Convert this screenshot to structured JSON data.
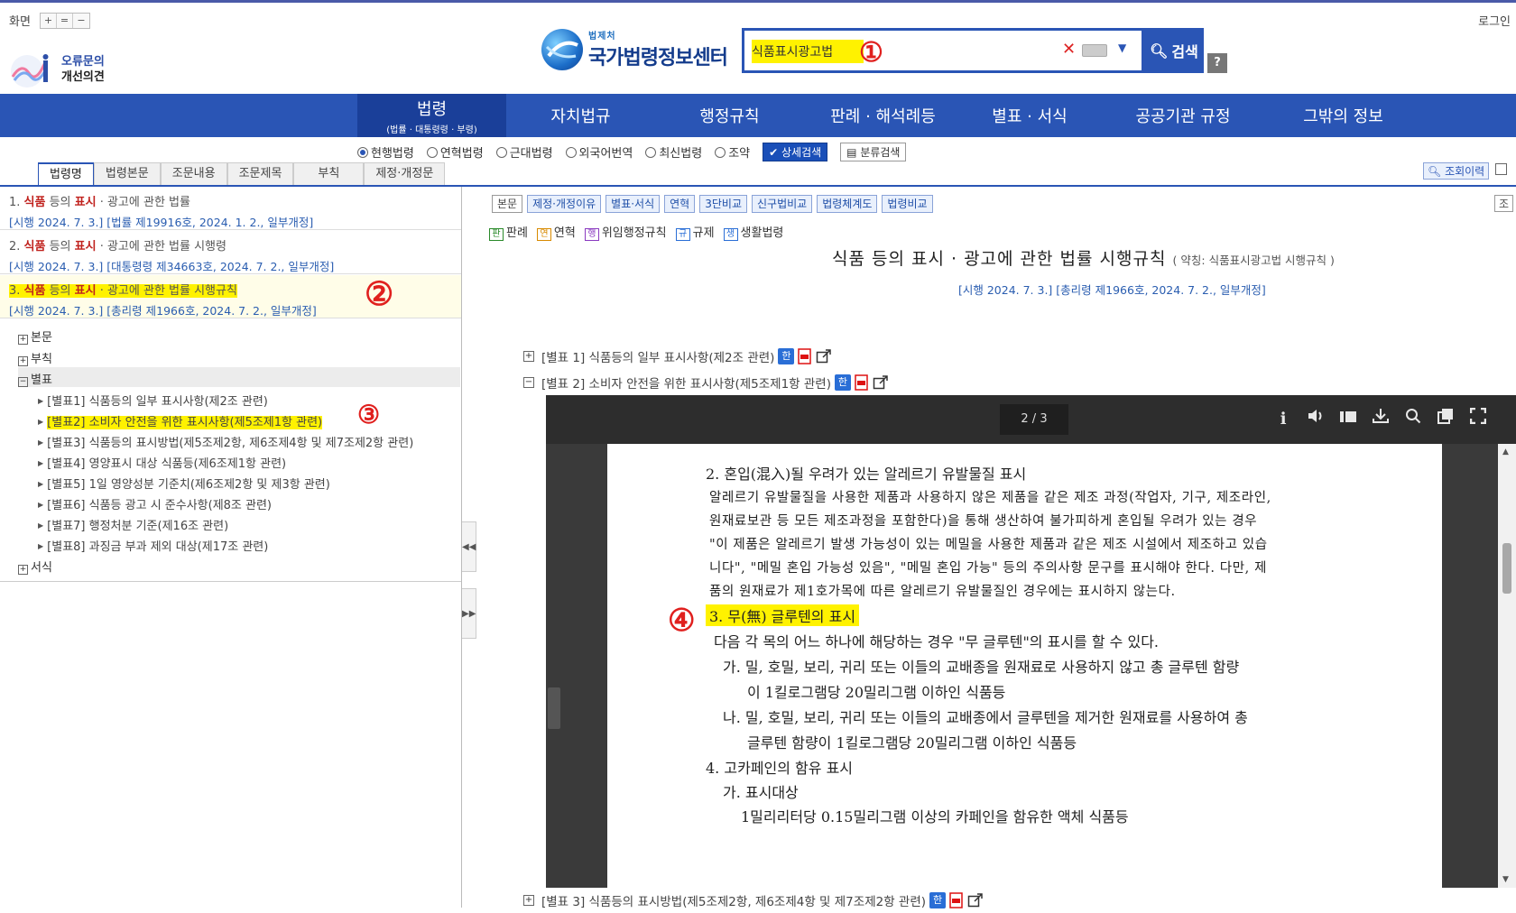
{
  "top": {
    "screen_label": "화면",
    "zoom_buttons": [
      "+",
      "=",
      "−"
    ],
    "login": "로그인",
    "feedback_line1": "오류문의",
    "feedback_line2": "개선의견",
    "logo_small": "법제처",
    "logo_big": "국가법령정보센터",
    "search_value": "식품표시광고법",
    "search_button": "검색",
    "help": "?"
  },
  "annotations": {
    "a1": "①",
    "a2": "②",
    "a3": "③",
    "a4": "④"
  },
  "nav": [
    {
      "label": "법령",
      "sub": "(법률 · 대통령령 · 부령)"
    },
    {
      "label": "자치법규"
    },
    {
      "label": "행정규칙"
    },
    {
      "label": "판례 · 해석례등"
    },
    {
      "label": "별표 · 서식"
    },
    {
      "label": "공공기관 규정"
    },
    {
      "label": "그밖의 정보"
    }
  ],
  "options": {
    "radios": [
      "현행법령",
      "연혁법령",
      "근대법령",
      "외국어번역",
      "최신법령",
      "조약"
    ],
    "detail_search": "상세검색",
    "category_search": "분류검색",
    "view_history": "조회이력"
  },
  "left_tabs": [
    "법령명",
    "법령본문",
    "조문내용",
    "조문제목",
    "부칙",
    "제정·개정문"
  ],
  "laws": [
    {
      "num": "1.",
      "a": "식품",
      "b": " 등의 ",
      "c": "표시",
      "d": " · 광고에 관한 법률",
      "sub": "[시행 2024. 7. 3.] [법률 제19916호, 2024. 1. 2., 일부개정]"
    },
    {
      "num": "2.",
      "a": "식품",
      "b": " 등의 ",
      "c": "표시",
      "d": " · 광고에 관한 법률 시행령",
      "sub": "[시행 2024. 7. 3.] [대통령령 제34663호, 2024. 7. 2., 일부개정]"
    },
    {
      "num": "3.",
      "a": "식품",
      "b": " 등의 ",
      "c": "표시",
      "d": " · 광고에 관한 법률 시행규칙",
      "sub": "[시행 2024. 7. 3.] [총리령 제1966호, 2024. 7. 2., 일부개정]"
    }
  ],
  "tree": {
    "body": "본문",
    "addenda": "부칙",
    "annex": "별표",
    "forms": "서식"
  },
  "annex_items": [
    "[별표1] 식품등의 일부 표시사항(제2조 관련)",
    "[별표2] 소비자 안전을 위한 표시사항(제5조제1항 관련)",
    "[별표3] 식품등의 표시방법(제5조제2항, 제6조제4항 및 제7조제2항 관련)",
    "[별표4] 영양표시 대상 식품등(제6조제1항 관련)",
    "[별표5] 1일 영양성분 기준치(제6조제2항 및 제3항 관련)",
    "[별표6] 식품등 광고 시 준수사항(제8조 관련)",
    "[별표7] 행정처분 기준(제16조 관련)",
    "[별표8] 과징금 부과 제외 대상(제17조 관련)"
  ],
  "right_buttons": [
    "본문",
    "제정·개정이유",
    "별표·서식",
    "연혁",
    "3단비교",
    "신구법비교",
    "법령체계도",
    "법령비교"
  ],
  "right_corner": "조",
  "legend": [
    {
      "icon": "판",
      "label": "판례"
    },
    {
      "icon": "연",
      "label": "연혁"
    },
    {
      "icon": "행",
      "label": "위임행정규칙"
    },
    {
      "icon": "규",
      "label": "규제"
    },
    {
      "icon": "생",
      "label": "생활법령"
    }
  ],
  "doc": {
    "title": "식품 등의 표시 · 광고에 관한 법률 시행규칙",
    "abbr": "( 약칭: 식품표시광고법 시행규칙 )",
    "sub": "[시행 2024. 7. 3.] [총리령 제1966호, 2024. 7. 2., 일부개정]"
  },
  "annex_rows": [
    {
      "sign": "+",
      "text": "[별표 1] 식품등의 일부 표시사항(제2조 관련)"
    },
    {
      "sign": "−",
      "text": "[별표 2] 소비자 안전을 위한 표시사항(제5조제1항 관련)"
    },
    {
      "sign": "+",
      "text": "[별표 3] 식품등의 표시방법(제5조제2항, 제6조제4항 및 제7조제2항 관련)"
    }
  ],
  "icons": {
    "info": "ℹ",
    "kor": "한",
    "pdf": "⬛",
    "share": "↗"
  },
  "viewer": {
    "page": "2 / 3",
    "page_progress": 0.67,
    "lines": [
      "2. 혼입(混入)될 우려가 있는 알레르기 유발물질 표시",
      "알레르기 유발물질을 사용한 제품과 사용하지 않은 제품을 같은 제조 과정(작업자, 기구, 제조라인,",
      "원재료보관 등 모든 제조과정을 포함한다)을 통해 생산하여 불가피하게 혼입될 우려가 있는 경우",
      "\"이 제품은 알레르기 발생 가능성이 있는 메밀을 사용한 제품과 같은 제조 시설에서 제조하고 있습",
      "니다\", \"메밀 혼입 가능성 있음\", \"메밀 혼입 가능\" 등의 주의사항 문구를 표시해야 한다. 다만, 제",
      "품의 원재료가 제1호가목에 따른 알레르기 유발물질인 경우에는 표시하지 않는다.",
      "3. 무(無) 글루텐의 표시",
      "다음 각 목의 어느 하나에 해당하는 경우 \"무 글루텐\"의 표시를 할 수 있다.",
      "가. 밀, 호밀, 보리, 귀리 또는 이들의 교배종을 원재료로 사용하지 않고 총 글루텐 함량",
      "이 1킬로그램당 20밀리그램 이하인 식품등",
      "나. 밀, 호밀, 보리, 귀리 또는 이들의 교배종에서 글루텐을 제거한 원재료를 사용하여 총",
      "글루텐 함량이 1킬로그램당 20밀리그램 이하인 식품등",
      "4. 고카페인의 함유 표시",
      "가. 표시대상",
      "1밀리리터당 0.15밀리그램 이상의 카페인을 함유한 액체 식품등"
    ]
  }
}
